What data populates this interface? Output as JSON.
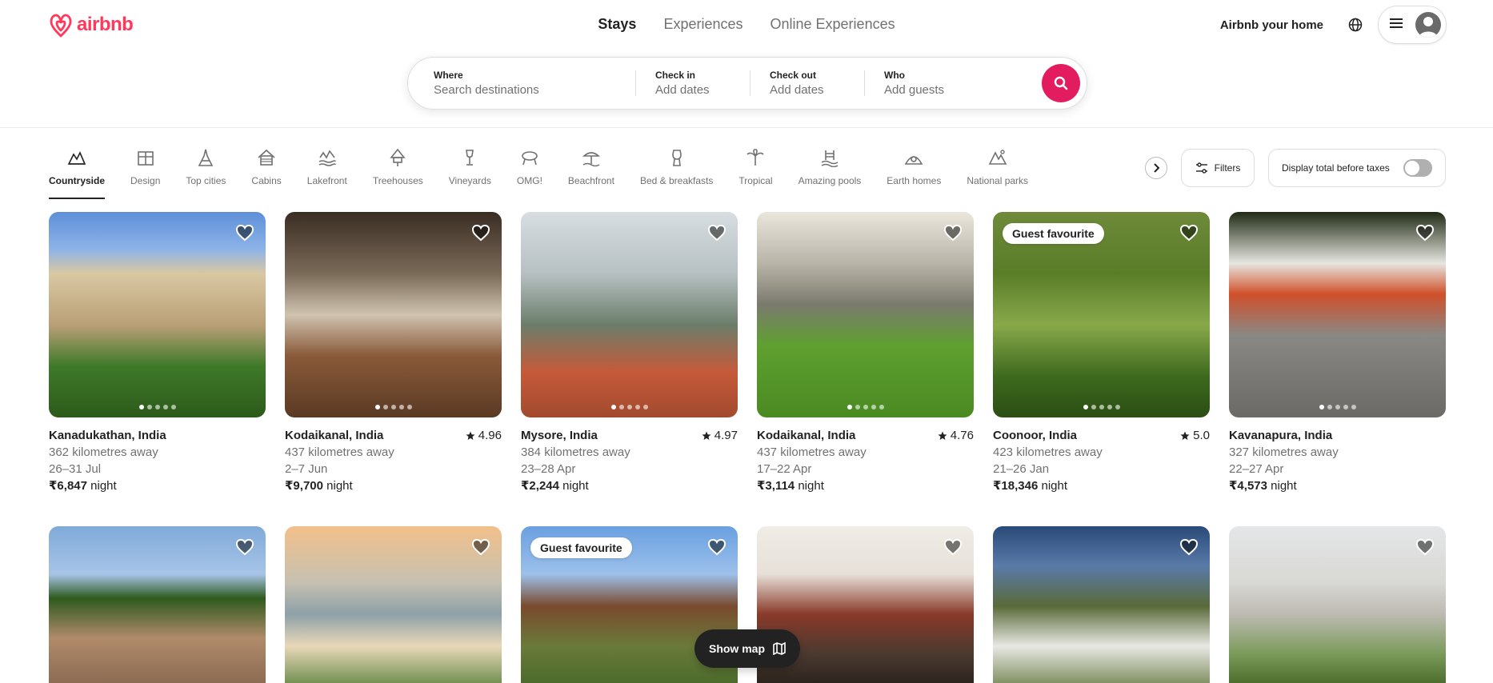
{
  "brand": {
    "name": "airbnb",
    "color": "#ff385c"
  },
  "top_tabs": [
    {
      "label": "Stays",
      "active": true
    },
    {
      "label": "Experiences",
      "active": false
    },
    {
      "label": "Online Experiences",
      "active": false
    }
  ],
  "nav": {
    "host_label": "Airbnb your home",
    "globe_icon": "globe-icon",
    "menu_icon": "hamburger-icon"
  },
  "search": {
    "where_label": "Where",
    "where_placeholder": "Search destinations",
    "checkin_label": "Check in",
    "checkin_value": "Add dates",
    "checkout_label": "Check out",
    "checkout_value": "Add dates",
    "who_label": "Who",
    "who_value": "Add guests",
    "button_icon": "search-icon"
  },
  "categories": [
    {
      "label": "Countryside",
      "active": true
    },
    {
      "label": "Design"
    },
    {
      "label": "Top cities"
    },
    {
      "label": "Cabins"
    },
    {
      "label": "Lakefront"
    },
    {
      "label": "Treehouses"
    },
    {
      "label": "Vineyards"
    },
    {
      "label": "OMG!"
    },
    {
      "label": "Beachfront"
    },
    {
      "label": "Bed & breakfasts"
    },
    {
      "label": "Tropical"
    },
    {
      "label": "Amazing pools"
    },
    {
      "label": "Earth homes"
    },
    {
      "label": "National parks"
    }
  ],
  "filters_label": "Filters",
  "tax_toggle_label": "Display total before taxes",
  "listings": [
    {
      "location": "Kanadukathan, India",
      "distance": "362 kilometres away",
      "dates": "26–31 Jul",
      "price": "₹6,847",
      "unit": "night",
      "rating": "",
      "badge": ""
    },
    {
      "location": "Kodaikanal, India",
      "distance": "437 kilometres away",
      "dates": "2–7 Jun",
      "price": "₹9,700",
      "unit": "night",
      "rating": "4.96",
      "badge": ""
    },
    {
      "location": "Mysore, India",
      "distance": "384 kilometres away",
      "dates": "23–28 Apr",
      "price": "₹2,244",
      "unit": "night",
      "rating": "4.97",
      "badge": ""
    },
    {
      "location": "Kodaikanal, India",
      "distance": "437 kilometres away",
      "dates": "17–22 Apr",
      "price": "₹3,114",
      "unit": "night",
      "rating": "4.76",
      "badge": ""
    },
    {
      "location": "Coonoor, India",
      "distance": "423 kilometres away",
      "dates": "21–26 Jan",
      "price": "₹18,346",
      "unit": "night",
      "rating": "5.0",
      "badge": "Guest favourite"
    },
    {
      "location": "Kavanapura, India",
      "distance": "327 kilometres away",
      "dates": "22–27 Apr",
      "price": "₹4,573",
      "unit": "night",
      "rating": "",
      "badge": ""
    }
  ],
  "row2_badges": [
    "",
    "",
    "Guest favourite",
    "",
    "",
    ""
  ],
  "show_map_label": "Show map"
}
